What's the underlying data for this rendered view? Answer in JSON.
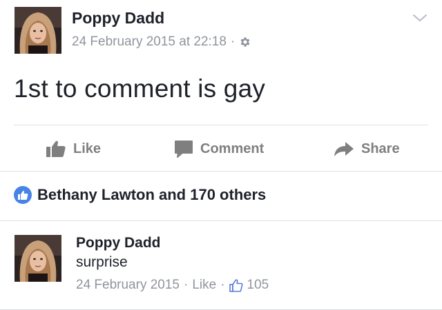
{
  "post": {
    "author": "Poppy Dadd",
    "timestamp": "24 February 2015 at 22:18",
    "separator": "·",
    "privacy_icon": "gear-icon",
    "menu_icon": "chevron-down-icon",
    "text": "1st to comment is gay"
  },
  "actions": {
    "like_label": "Like",
    "comment_label": "Comment",
    "share_label": "Share"
  },
  "reactions": {
    "summary": "Bethany Lawton and 170 others"
  },
  "comment": {
    "author": "Poppy Dadd",
    "text": "surprise",
    "date": "24 February 2015",
    "separator": "·",
    "like_label": "Like",
    "like_count": "105"
  },
  "colors": {
    "text": "#1d2129",
    "meta": "#90949c",
    "action": "#7f7f7f",
    "accent": "#4a83e7",
    "divider": "#dddfe2"
  }
}
